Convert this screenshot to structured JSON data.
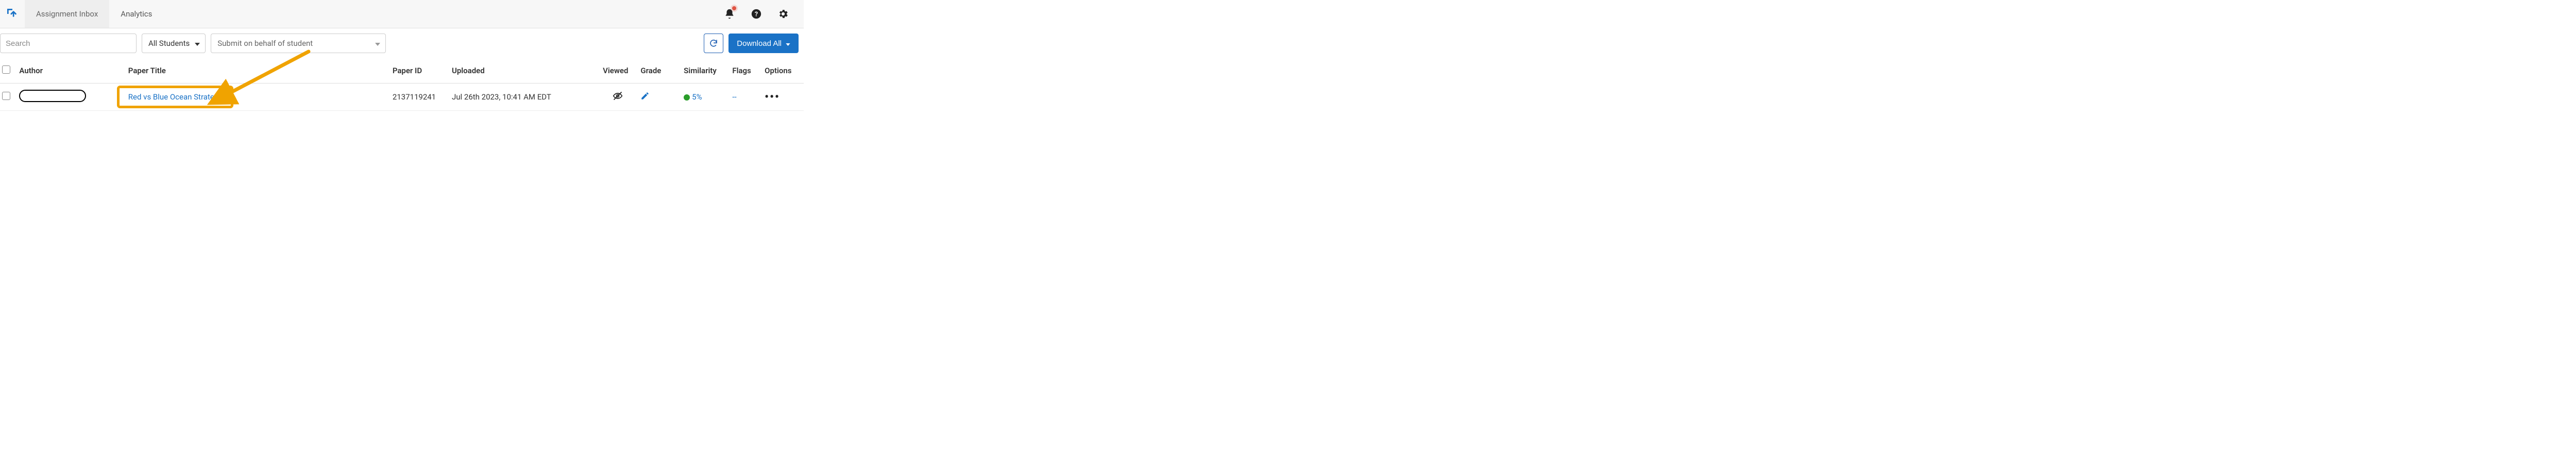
{
  "nav": {
    "tabs": [
      {
        "label": "Assignment Inbox"
      },
      {
        "label": "Analytics"
      }
    ]
  },
  "toolbar": {
    "search_placeholder": "Search",
    "students_filter": "All Students",
    "submit_placeholder": "Submit on behalf of student",
    "download_label": "Download All"
  },
  "columns": {
    "author": "Author",
    "paper_title": "Paper Title",
    "paper_id": "Paper ID",
    "uploaded": "Uploaded",
    "viewed": "Viewed",
    "grade": "Grade",
    "similarity": "Similarity",
    "flags": "Flags",
    "options": "Options"
  },
  "rows": [
    {
      "author": "",
      "paper_title": "Red vs Blue Ocean Strategy",
      "paper_id": "2137119241",
      "uploaded": "Jul 26th 2023, 10:41 AM EDT",
      "similarity_pct": "5%",
      "similarity_color": "#2a9d2a",
      "flags": "--"
    }
  ]
}
